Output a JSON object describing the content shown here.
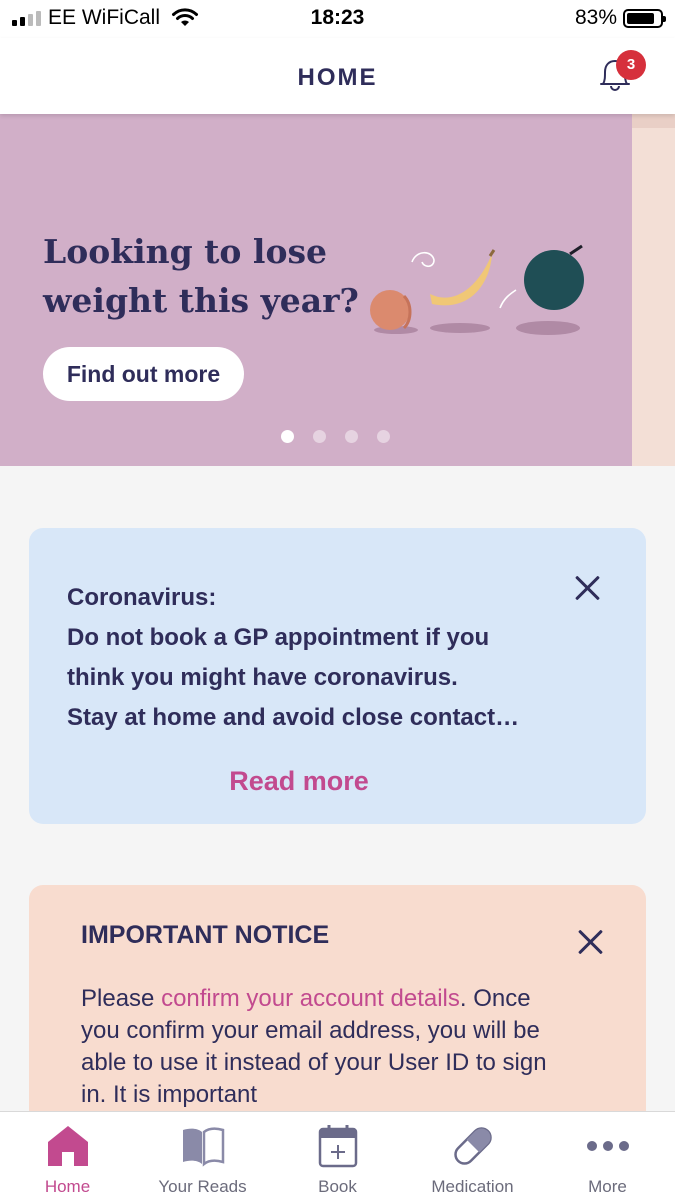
{
  "status_bar": {
    "carrier": "EE WiFiCall",
    "time": "18:23",
    "battery": "83%",
    "battery_level": 0.83
  },
  "header": {
    "title": "HOME",
    "notification_count": "3"
  },
  "hero": {
    "title": "Looking to lose weight this year?",
    "button_label": "Find out more",
    "slide_count": 4,
    "active_slide": 1
  },
  "covid_card": {
    "lines": [
      "Coronavirus:",
      "Do not book a GP appointment if you",
      "think you might have coronavirus.",
      "Stay at home and avoid close contact…"
    ],
    "read_more": "Read more"
  },
  "notice_card": {
    "title": "IMPORTANT NOTICE",
    "text_before": "Please ",
    "link": "confirm your account details",
    "text_after": ". Once you confirm your email address, you will be able to use it instead of your User ID to sign in. It is important"
  },
  "tabs": [
    {
      "label": "Home",
      "icon": "home-icon",
      "active": true
    },
    {
      "label": "Your Reads",
      "icon": "book-open-icon",
      "active": false
    },
    {
      "label": "Book",
      "icon": "calendar-add-icon",
      "active": false
    },
    {
      "label": "Medication",
      "icon": "pill-icon",
      "active": false
    },
    {
      "label": "More",
      "icon": "more-dots-icon",
      "active": false
    }
  ],
  "colors": {
    "primary_text": "#2f2d5a",
    "accent": "#c24a8f",
    "hero_bg": "#d1afc8",
    "covid_bg": "#d8e7f8",
    "notice_bg": "#f8dccf",
    "badge": "#d6303c"
  }
}
